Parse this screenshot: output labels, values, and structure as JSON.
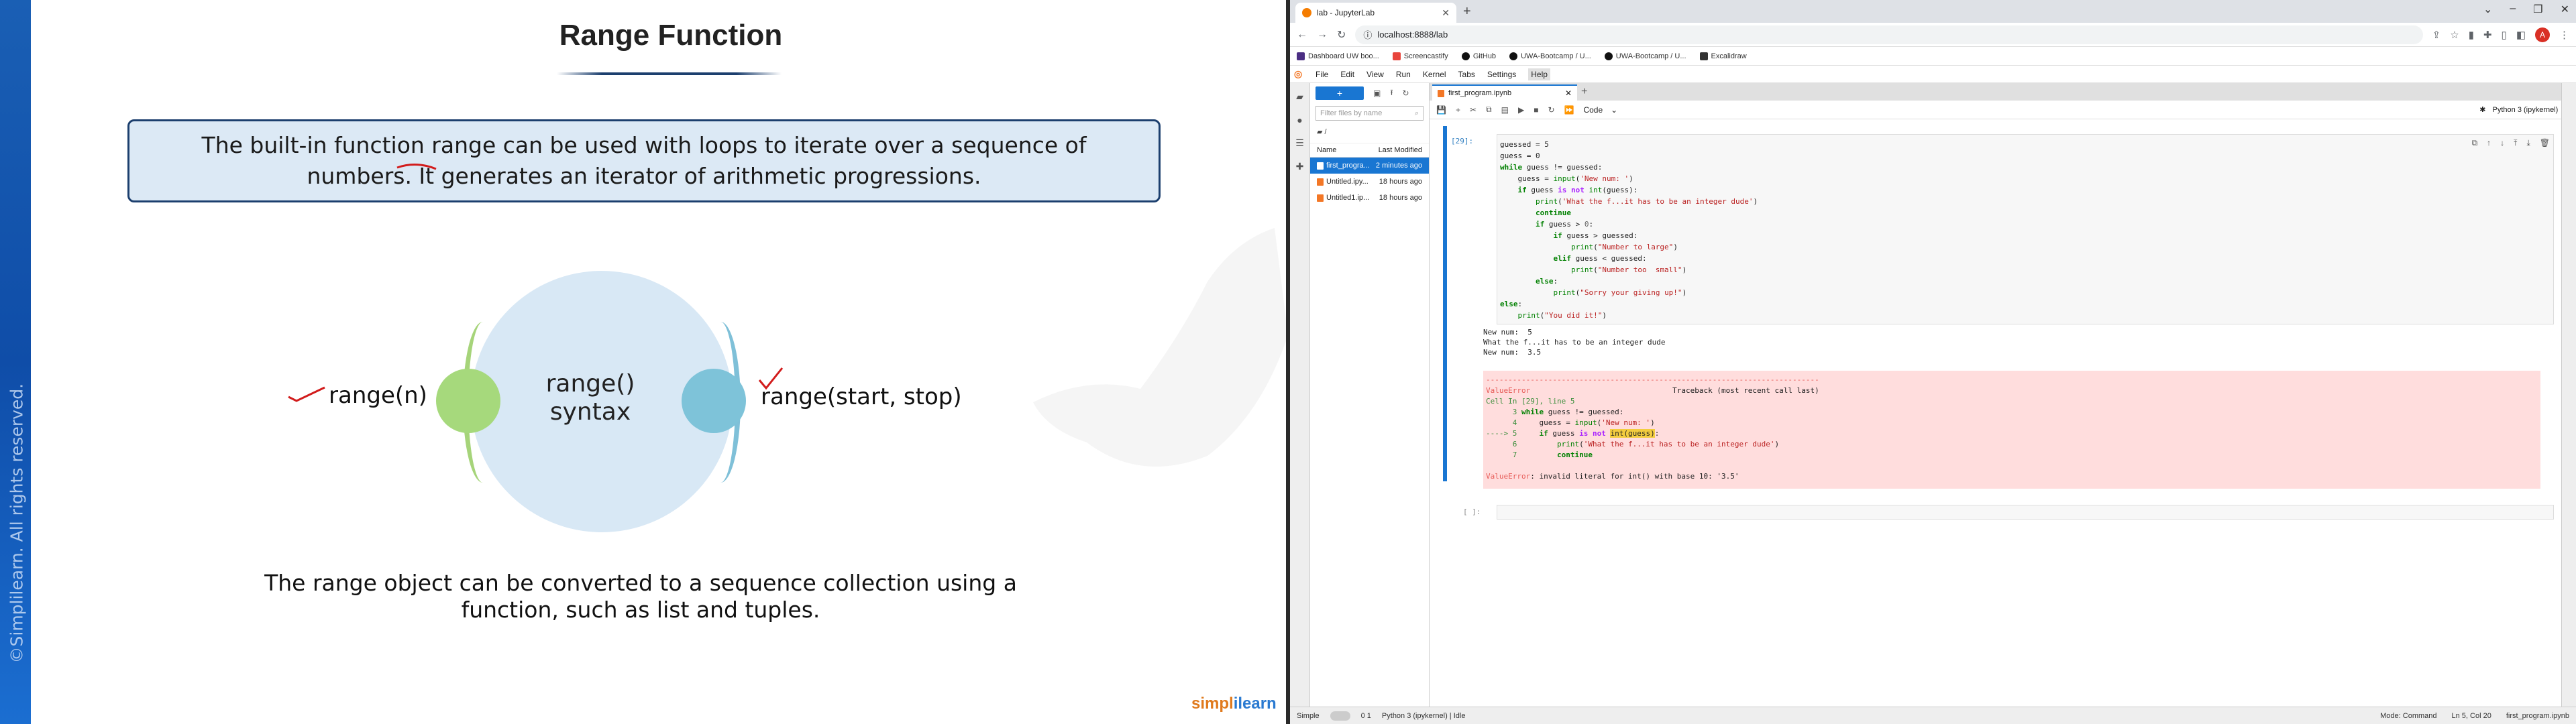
{
  "slide": {
    "title": "Range Function",
    "definition": "The built-in function range can be used with loops to iterate over a sequence of numbers. It generates an iterator of arithmetic progressions.",
    "center_label_line1": "range()",
    "center_label_line2": "syntax",
    "left_label": "range(n)",
    "right_label": "range(start, stop)",
    "bottom_text": "The range object can be converted to a sequence collection using a function, such as list and tuples.",
    "copyright": "©Simplilearn. All rights reserved.",
    "logo_part1": "simpl",
    "logo_part2": "ilearn",
    "colors": {
      "bar": "#1a5fb4",
      "box_bg": "#dce9f5",
      "circle": "#d8e8f5",
      "green": "#a6d97c",
      "blue": "#7ec3d9"
    }
  },
  "browser": {
    "tab_title": "lab - JupyterLab",
    "url": "localhost:8888/lab",
    "bookmarks": [
      "Dashboard UW boo...",
      "Screencastify",
      "GitHub",
      "UWA-Bootcamp / U...",
      "UWA-Bootcamp / U...",
      "Excalidraw"
    ],
    "profile_initial": "A"
  },
  "jupyter": {
    "menu": [
      "File",
      "Edit",
      "View",
      "Run",
      "Kernel",
      "Tabs",
      "Settings",
      "Help"
    ],
    "active_menu": "Help",
    "filter_placeholder": "Filter files by name",
    "path": "/",
    "col_name": "Name",
    "col_modified": "Last Modified",
    "files": [
      {
        "name": "first_progra...",
        "modified": "2 minutes ago"
      },
      {
        "name": "Untitled.ipy...",
        "modified": "18 hours ago"
      },
      {
        "name": "Untitled1.ip...",
        "modified": "18 hours ago"
      }
    ],
    "doc_tab": "first_program.ipynb",
    "cell_type": "Code",
    "kernel": "Python 3 (ipykernel)",
    "prompt": "[29]:",
    "empty_prompt": "[ ]:",
    "output_lines": "New num:  5\nWhat the f...it has to be an integer dude\nNew num:  3.5",
    "status": {
      "mode_label": "Simple",
      "counts": "0  1",
      "kernel_status": "Python 3 (ipykernel) | Idle",
      "mode": "Mode: Command",
      "position": "Ln 5, Col 20",
      "file": "first_program.ipynb"
    }
  }
}
